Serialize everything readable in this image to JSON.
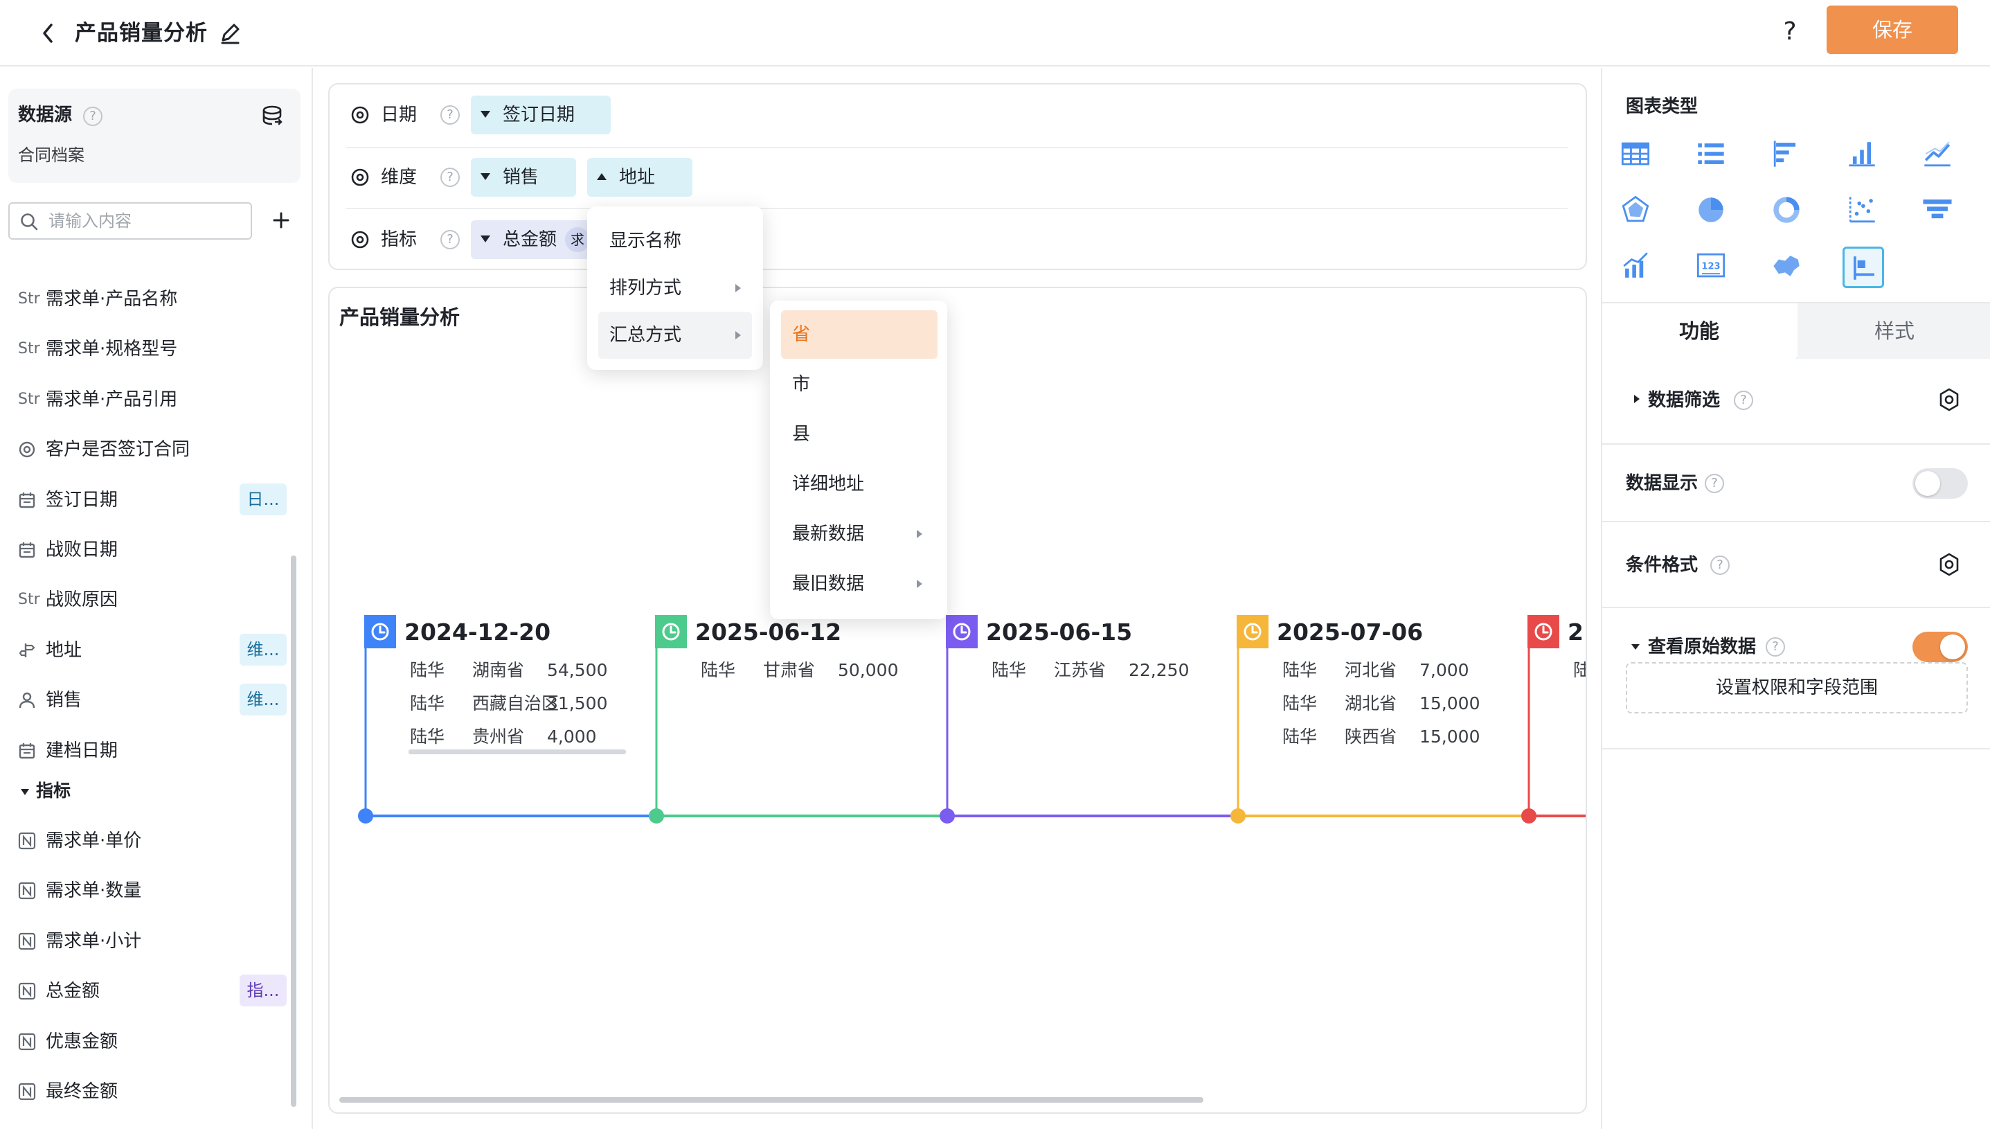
{
  "header": {
    "title": "产品销量分析",
    "help": "?",
    "save_label": "保存"
  },
  "left": {
    "datasource_title": "数据源",
    "datasource_help": "?",
    "datasource_name": "合同档案",
    "search_placeholder": "请输入内容",
    "fields": [
      {
        "icon": "Str",
        "label": "需求单·产品名称",
        "tag": ""
      },
      {
        "icon": "Str",
        "label": "需求单·规格型号",
        "tag": ""
      },
      {
        "icon": "Str",
        "label": "需求单·产品引用",
        "tag": ""
      },
      {
        "icon": "radio",
        "label": "客户是否签订合同",
        "tag": ""
      },
      {
        "icon": "date",
        "label": "签订日期",
        "tag": "日..."
      },
      {
        "icon": "date",
        "label": "战败日期",
        "tag": ""
      },
      {
        "icon": "Str",
        "label": "战败原因",
        "tag": ""
      },
      {
        "icon": "location",
        "label": "地址",
        "tag": "维..."
      },
      {
        "icon": "user",
        "label": "销售",
        "tag": "维..."
      },
      {
        "icon": "date",
        "label": "建档日期",
        "tag": ""
      }
    ],
    "metrics_section": "指标",
    "metrics": [
      {
        "icon": "N",
        "label": "需求单·单价",
        "tag": ""
      },
      {
        "icon": "N",
        "label": "需求单·数量",
        "tag": ""
      },
      {
        "icon": "N",
        "label": "需求单·小计",
        "tag": ""
      },
      {
        "icon": "N",
        "label": "总金额",
        "tag": "指..."
      },
      {
        "icon": "N",
        "label": "优惠金额",
        "tag": ""
      },
      {
        "icon": "N",
        "label": "最终金额",
        "tag": ""
      }
    ]
  },
  "config": {
    "rows": [
      {
        "label": "日期",
        "help": "?",
        "pills": [
          {
            "label": "签订日期",
            "arrow": "down"
          }
        ]
      },
      {
        "label": "维度",
        "help": "?",
        "pills": [
          {
            "label": "销售",
            "arrow": "down"
          },
          {
            "label": "地址",
            "arrow": "up"
          }
        ]
      },
      {
        "label": "指标",
        "help": "?",
        "pills": [
          {
            "label": "总金额",
            "arrow": "down",
            "badge": "求"
          }
        ]
      }
    ]
  },
  "menu": {
    "items": [
      "显示名称",
      "排列方式",
      "汇总方式"
    ],
    "submenu": [
      "省",
      "市",
      "县",
      "详细地址",
      "最新数据",
      "最旧数据"
    ]
  },
  "chart": {
    "title": "产品销量分析"
  },
  "chart_data": {
    "type": "timeline",
    "events": [
      {
        "date": "2024-12-20",
        "color": "#3f83f8",
        "rows": [
          [
            "陆华",
            "湖南省",
            "54,500"
          ],
          [
            "陆华",
            "西藏自治区",
            "31,500"
          ],
          [
            "陆华",
            "贵州省",
            "4,000"
          ]
        ]
      },
      {
        "date": "2025-06-12",
        "color": "#4ccb8c",
        "rows": [
          [
            "陆华",
            "甘肃省",
            "50,000"
          ]
        ]
      },
      {
        "date": "2025-06-15",
        "color": "#7b5cf0",
        "rows": [
          [
            "陆华",
            "江苏省",
            "22,250"
          ]
        ]
      },
      {
        "date": "2025-07-06",
        "color": "#f5b63a",
        "rows": [
          [
            "陆华",
            "河北省",
            "7,000"
          ],
          [
            "陆华",
            "湖北省",
            "15,000"
          ],
          [
            "陆华",
            "陕西省",
            "15,000"
          ]
        ]
      },
      {
        "date": "2",
        "color": "#e84a4a",
        "rows": [
          [
            "陆"
          ]
        ]
      }
    ]
  },
  "right": {
    "chart_type_title": "图表类型",
    "chart_types": [
      "table",
      "list",
      "bar-horizontal",
      "bar",
      "line",
      "radar",
      "pie",
      "donut",
      "scatter",
      "funnel",
      "combo",
      "number",
      "map",
      "timeline"
    ],
    "selected_chart_type": "timeline",
    "tabs": [
      "功能",
      "样式"
    ],
    "sections": {
      "filter": "数据筛选",
      "display": "数据显示",
      "conditional": "条件格式",
      "raw": "查看原始数据",
      "permission_button": "设置权限和字段范围"
    },
    "display_on": false,
    "raw_on": true,
    "help": "?"
  }
}
